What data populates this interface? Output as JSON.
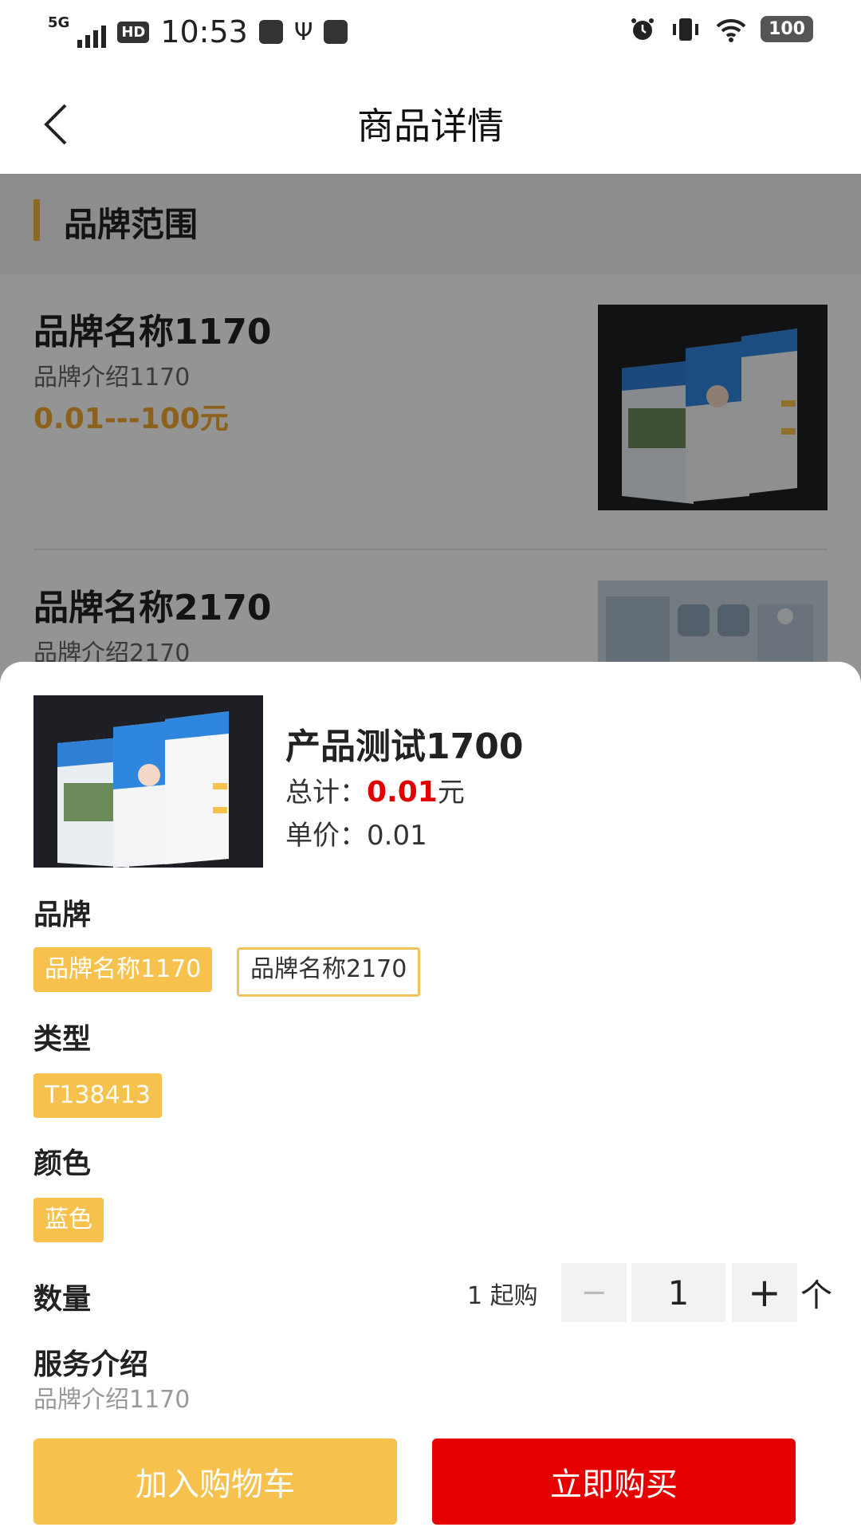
{
  "status_bar": {
    "network": "5G",
    "hd": "HD",
    "time": "10:53",
    "battery": "100",
    "icons": [
      "signal-icon",
      "hd-icon",
      "usb-icon",
      "app-icon",
      "alarm-icon",
      "vibrate-icon",
      "wifi-icon",
      "battery-icon"
    ]
  },
  "header": {
    "title": "商品详情",
    "back_icon": "chevron-left-icon"
  },
  "background_list": {
    "section_title": "品牌范围",
    "items": [
      {
        "name": "品牌名称1170",
        "desc": "品牌介绍1170",
        "price": "0.01---100元"
      },
      {
        "name": "品牌名称2170",
        "desc": "品牌介绍2170",
        "price": ""
      }
    ]
  },
  "sheet": {
    "product_name": "产品测试1700",
    "total_label": "总计：",
    "total_value": "0.01",
    "total_unit": "元",
    "unit_price_label": "单价：",
    "unit_price_value": "0.01",
    "brand_label": "品牌",
    "brand_options": [
      {
        "label": "品牌名称1170",
        "selected": true
      },
      {
        "label": "品牌名称2170",
        "selected": false
      }
    ],
    "type_label": "类型",
    "type_options": [
      {
        "label": "T138413",
        "selected": true
      }
    ],
    "color_label": "颜色",
    "color_options": [
      {
        "label": "蓝色",
        "selected": true
      }
    ],
    "quantity_label": "数量",
    "min_purchase": "1 起购",
    "quantity": "1",
    "minus": "−",
    "plus": "+",
    "quantity_unit": "个",
    "service_label": "服务介绍",
    "service_desc": "品牌介绍1170",
    "add_to_cart": "加入购物车",
    "buy_now": "立即购买"
  },
  "colors": {
    "accent_yellow": "#f7c14e",
    "buy_red": "#e60000",
    "price_orange": "#f2a830",
    "price_red": "#e00000"
  }
}
